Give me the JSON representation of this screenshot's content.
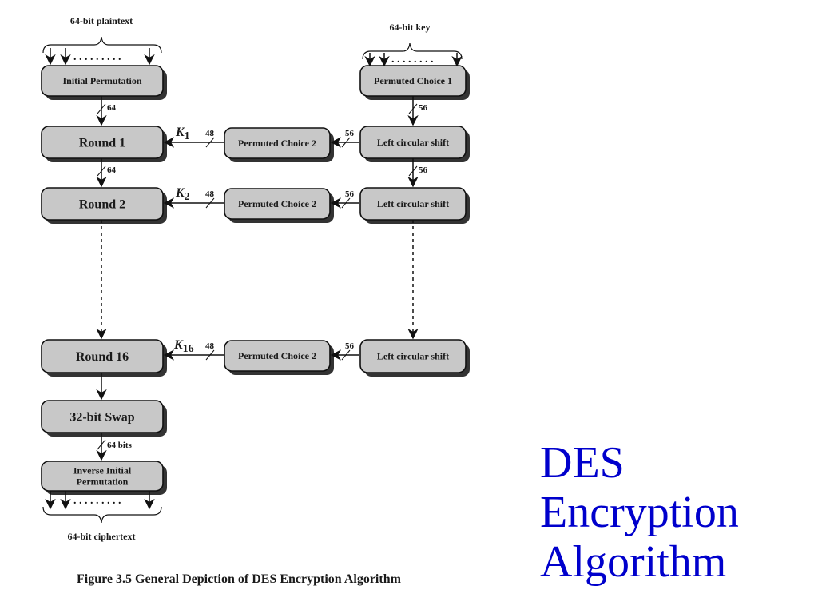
{
  "slide": {
    "title_lines": [
      "DES",
      "Encryption",
      "Algorithm"
    ],
    "title_color": "#0000cc"
  },
  "figure": {
    "caption": "Figure 3.5  General Depiction of DES Encryption Algorithm",
    "input_label": "64-bit plaintext",
    "key_label": "64-bit key",
    "output_label": "64-bit ciphertext",
    "box_fill": "#c8c8c8",
    "left_column": [
      {
        "id": "ip",
        "label": "Initial Permutation"
      },
      {
        "id": "round1",
        "label": "Round 1"
      },
      {
        "id": "round2",
        "label": "Round 2"
      },
      {
        "id": "round16",
        "label": "Round 16"
      },
      {
        "id": "swap",
        "label": "32-bit Swap"
      },
      {
        "id": "iip",
        "label_lines": [
          "Inverse Initial",
          "Permutation"
        ]
      }
    ],
    "key_column": [
      {
        "id": "pc1",
        "label": "Permuted Choice 1"
      },
      {
        "id": "lcs1",
        "label": "Left circular shift"
      },
      {
        "id": "lcs2",
        "label": "Left circular shift"
      },
      {
        "id": "lcs16",
        "label": "Left circular shift"
      }
    ],
    "pc2_boxes": [
      {
        "id": "pc2-1",
        "label": "Permuted Choice 2",
        "key": "K",
        "sub": "1"
      },
      {
        "id": "pc2-2",
        "label": "Permuted Choice 2",
        "key": "K",
        "sub": "2"
      },
      {
        "id": "pc2-16",
        "label": "Permuted Choice 2",
        "key": "K",
        "sub": "16"
      }
    ],
    "bit_widths": {
      "ip_to_round1": "64",
      "round1_to_round2": "64",
      "swap_to_iip": "64 bits",
      "pc1_to_lcs": "56",
      "lcs1_to_lcs2": "56",
      "lcs_to_pc2": "56",
      "pc2_to_round": "48"
    }
  }
}
